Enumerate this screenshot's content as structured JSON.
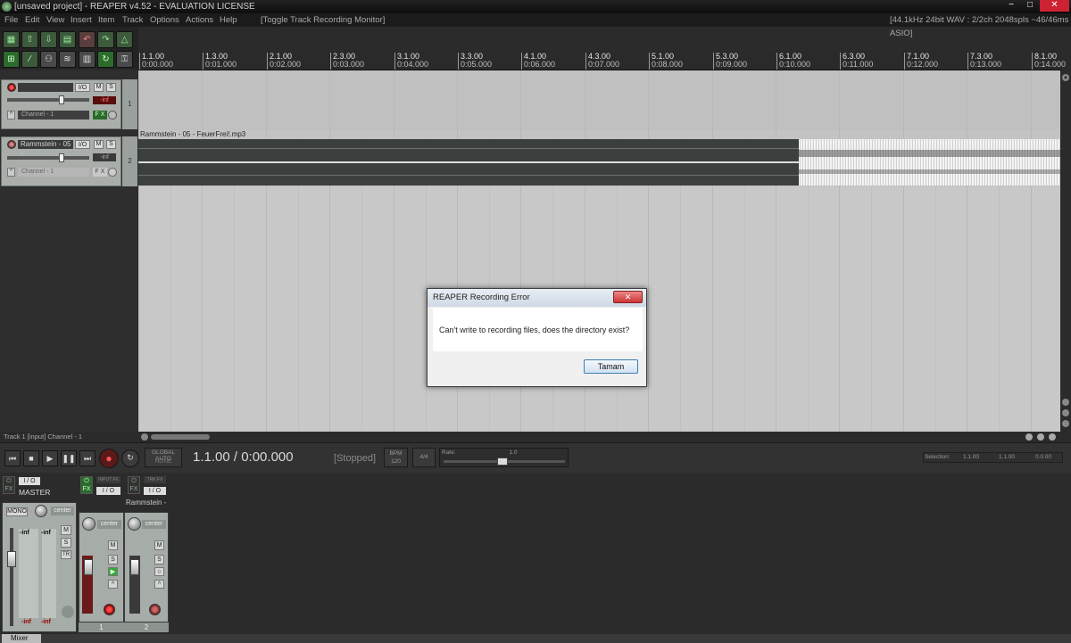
{
  "window": {
    "title": "[unsaved project] - REAPER v4.52 - EVALUATION LICENSE",
    "minimize": "−",
    "maximize": "□",
    "close": "✕"
  },
  "menu": {
    "items": [
      "File",
      "Edit",
      "View",
      "Insert",
      "Item",
      "Track",
      "Options",
      "Actions",
      "Help"
    ],
    "action_hint": "[Toggle Track Recording Monitor]",
    "audio_status": "[44.1kHz 24bit WAV : 2/2ch 2048spls ~46/46ms ASIO]"
  },
  "ruler": {
    "ticks": [
      {
        "bar": "1.1.00",
        "time": "0:00.000"
      },
      {
        "bar": "1.3.00",
        "time": "0:01.000"
      },
      {
        "bar": "2.1.00",
        "time": "0:02.000"
      },
      {
        "bar": "2.3.00",
        "time": "0:03.000"
      },
      {
        "bar": "3.1.00",
        "time": "0:04.000"
      },
      {
        "bar": "3.3.00",
        "time": "0:05.000"
      },
      {
        "bar": "4.1.00",
        "time": "0:06.000"
      },
      {
        "bar": "4.3.00",
        "time": "0:07.000"
      },
      {
        "bar": "5.1.00",
        "time": "0:08.000"
      },
      {
        "bar": "5.3.00",
        "time": "0:09.000"
      },
      {
        "bar": "6.1.00",
        "time": "0:10.000"
      },
      {
        "bar": "6.3.00",
        "time": "0:11.000"
      },
      {
        "bar": "7.1.00",
        "time": "0:12.000"
      },
      {
        "bar": "7.3.00",
        "time": "0:13.000"
      },
      {
        "bar": "8.1.00",
        "time": "0:14.000"
      }
    ]
  },
  "tracks": [
    {
      "number": "1",
      "name": "",
      "io": "I/O",
      "mute": "M",
      "solo": "S",
      "volume": "-inf",
      "channel": "Channel - 1",
      "fx": "F X"
    },
    {
      "number": "2",
      "name": "Rammstein - 05 -",
      "io": "I/O",
      "mute": "M",
      "solo": "S",
      "volume": "-inf",
      "channel": "Channel - 1",
      "fx": "F X"
    }
  ],
  "item": {
    "label": "Rammstein - 05 - FeuerFrei!.mp3"
  },
  "status_line": "Track 1 [input] Channel - 1",
  "transport": {
    "global_auto": "GLOBAL AUTO",
    "global_auto_sub": "NONE",
    "time": "1.1.00 / 0:00.000",
    "state": "[Stopped]",
    "bpm_label": "BPM",
    "bpm": "120",
    "timesig": "4/4",
    "rate_label": "Rate:",
    "rate": "1.0",
    "selection_label": "Selection:",
    "selection_start": "1.1.00",
    "selection_end": "1.1.00",
    "selection_len": "0.0.00"
  },
  "mixer": {
    "tab": "Mixer",
    "master": {
      "name": "MASTER",
      "io": "I / O",
      "mono": "MONO",
      "pan": "center",
      "peak_l": "-inf",
      "peak_r": "-inf",
      "bottom_l": "-inf",
      "bottom_r": "-inf",
      "mute": "M",
      "solo": "S",
      "tr": "TR",
      "scale_left": [
        "6",
        "0",
        "6",
        "12",
        "18",
        "24",
        "30",
        "36",
        "42"
      ],
      "scale_mid": [
        "12",
        "18",
        "24",
        "30",
        "36",
        "42",
        "48",
        "54"
      ],
      "scale_mid2": [
        "-6",
        "-12",
        "-18",
        "-30",
        "-42",
        "-54"
      ]
    },
    "strips": [
      {
        "label": "INPUT FX",
        "io": "I / O",
        "name": "",
        "pan": "center",
        "number": "1",
        "mute": "M",
        "solo": "S"
      },
      {
        "label": "TRK FX",
        "io": "I / O",
        "name": "Rammstein - 0",
        "pan": "center",
        "number": "2",
        "mute": "M",
        "solo": "S"
      }
    ]
  },
  "dialog": {
    "title": "REAPER Recording Error",
    "message": "Can't write to recording files, does the directory exist?",
    "ok": "Tamam",
    "close": "✕"
  }
}
